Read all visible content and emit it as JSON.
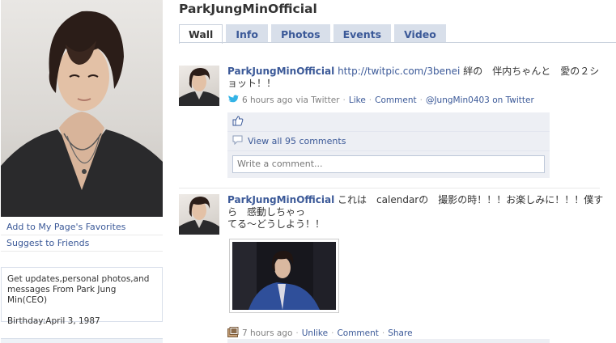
{
  "page": {
    "title": "ParkJungMinOfficial"
  },
  "tabs": [
    {
      "label": "Wall"
    },
    {
      "label": "Info"
    },
    {
      "label": "Photos"
    },
    {
      "label": "Events"
    },
    {
      "label": "Video"
    }
  ],
  "sidebar": {
    "favorites_link": "Add to My Page's Favorites",
    "suggest_link": "Suggest to Friends",
    "info_text": "Get updates,personal photos,and messages From Park Jung Min(CEO)",
    "birthday": "Birthday:April 3, 1987"
  },
  "posts": [
    {
      "author": "ParkJungMinOfficial",
      "link": "http://twitpic.com/3benei",
      "text": " 絆の　伴内ちゃんと　愛の２ショット！！",
      "time": "6 hours ago",
      "via": "via Twitter",
      "like": "Like",
      "comment": "Comment",
      "twitter_link": "@JungMin0403 on Twitter",
      "view_comments": "View all 95 comments",
      "write_placeholder": "Write a comment..."
    },
    {
      "author": "ParkJungMinOfficial",
      "text_line1": " これは　calendarの　撮影の時！！！お楽しみに！！！僕すら　感動しちゃっ",
      "text_line2": "てる～どうしよう！！",
      "time": "7 hours ago",
      "unlike": "Unlike",
      "comment": "Comment",
      "share": "Share"
    }
  ],
  "colors": {
    "link": "#3b5998",
    "tab_bg": "#d8dfea",
    "feedback_bg": "#edeff4"
  }
}
